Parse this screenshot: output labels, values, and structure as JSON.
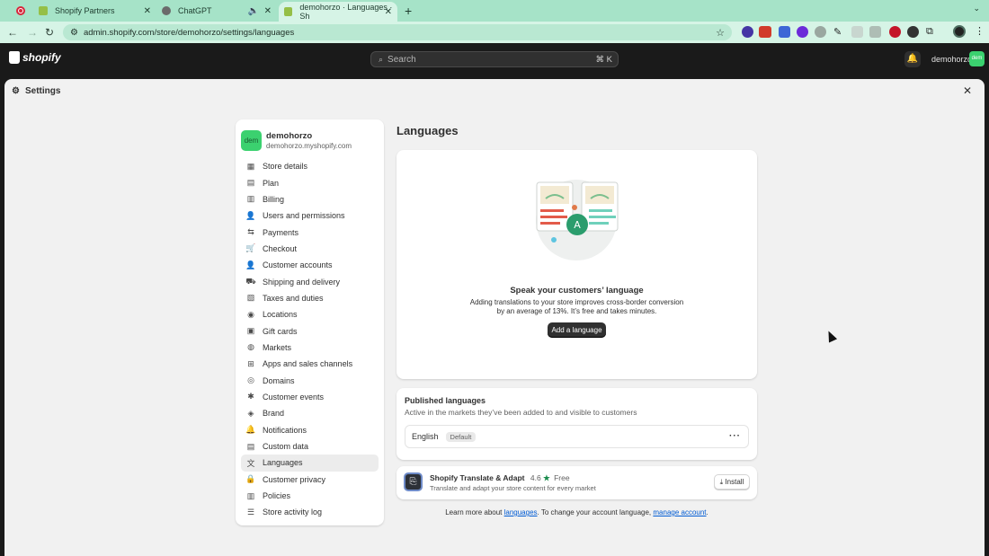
{
  "browser": {
    "tabs": [
      {
        "title": "Shopify Partners",
        "favicon_color": "#95bf47"
      },
      {
        "title": "ChatGPT",
        "favicon_color": "#6b6b6b"
      },
      {
        "title": "demohorzo · Languages · Sh",
        "favicon_color": "#95bf47"
      }
    ],
    "url": "admin.shopify.com/store/demohorzo/settings/languages",
    "ext_badge_1": "11",
    "ext_badge_2": "72M"
  },
  "topbar": {
    "logo_text": "shopify",
    "search_placeholder": "Search",
    "search_shortcut": "⌘ K",
    "store_name": "demohorzo",
    "store_badge": "dem"
  },
  "settings": {
    "title": "Settings",
    "store": {
      "name": "demohorzo",
      "domain": "demohorzo.myshopify.com",
      "avatar": "dem"
    },
    "nav": [
      {
        "label": "Store details",
        "icon": "store-icon",
        "glyph": "▦"
      },
      {
        "label": "Plan",
        "icon": "plan-icon",
        "glyph": "▤"
      },
      {
        "label": "Billing",
        "icon": "billing-icon",
        "glyph": "▥"
      },
      {
        "label": "Users and permissions",
        "icon": "users-icon",
        "glyph": "👤"
      },
      {
        "label": "Payments",
        "icon": "payments-icon",
        "glyph": "⇆"
      },
      {
        "label": "Checkout",
        "icon": "cart-icon",
        "glyph": "🛒"
      },
      {
        "label": "Customer accounts",
        "icon": "person-icon",
        "glyph": "👤"
      },
      {
        "label": "Shipping and delivery",
        "icon": "truck-icon",
        "glyph": "⛟"
      },
      {
        "label": "Taxes and duties",
        "icon": "tax-icon",
        "glyph": "▧"
      },
      {
        "label": "Locations",
        "icon": "location-icon",
        "glyph": "◉"
      },
      {
        "label": "Gift cards",
        "icon": "gift-icon",
        "glyph": "▣"
      },
      {
        "label": "Markets",
        "icon": "globe-icon",
        "glyph": "◍"
      },
      {
        "label": "Apps and sales channels",
        "icon": "apps-icon",
        "glyph": "⊞"
      },
      {
        "label": "Domains",
        "icon": "domain-icon",
        "glyph": "◎"
      },
      {
        "label": "Customer events",
        "icon": "events-icon",
        "glyph": "✱"
      },
      {
        "label": "Brand",
        "icon": "brand-icon",
        "glyph": "◈"
      },
      {
        "label": "Notifications",
        "icon": "bell-icon",
        "glyph": "🔔"
      },
      {
        "label": "Custom data",
        "icon": "data-icon",
        "glyph": "▤"
      },
      {
        "label": "Languages",
        "icon": "language-icon",
        "glyph": "文"
      },
      {
        "label": "Customer privacy",
        "icon": "lock-icon",
        "glyph": "🔒"
      },
      {
        "label": "Policies",
        "icon": "policy-icon",
        "glyph": "▥"
      },
      {
        "label": "Store activity log",
        "icon": "log-icon",
        "glyph": "☰"
      }
    ],
    "selected": "Languages"
  },
  "languages": {
    "title": "Languages",
    "hero": {
      "heading": "Speak your customers’ language",
      "description": "Adding translations to your store improves cross-border conversion by an average of 13%. It’s free and takes minutes.",
      "button": "Add a language"
    },
    "published": {
      "title": "Published languages",
      "subtitle": "Active in the markets they’ve been added to and visible to customers",
      "languages": [
        {
          "name": "English",
          "badge": "Default"
        }
      ]
    },
    "app": {
      "name": "Shopify Translate & Adapt",
      "rating": "4.6",
      "price": "Free",
      "description": "Translate and adapt your store content for every market",
      "button": "Install"
    },
    "footer": {
      "prefix": "Learn more about ",
      "link1": "languages",
      "middle": ". To change your account language, ",
      "link2": "manage account",
      "suffix": "."
    }
  },
  "colors": {
    "accent": "#3bd16f",
    "tabbar": "#a6e3c8",
    "topbar": "#1a1a1a",
    "link": "#005bd3"
  }
}
